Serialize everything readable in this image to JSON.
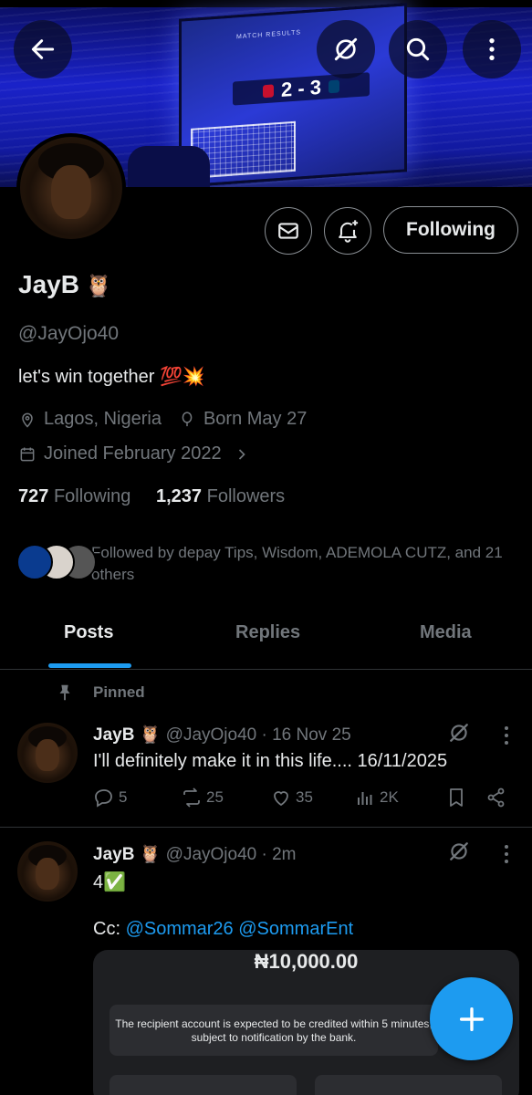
{
  "banner": {
    "tv_title": "MATCH RESULTS",
    "score": "2 - 3"
  },
  "header_buttons": [
    "back-icon",
    "grok-icon",
    "search-icon",
    "more-icon"
  ],
  "profile": {
    "name": "JayB",
    "name_emoji": "🦉",
    "handle": "@JayOjo40",
    "bio": "let's win together 💯💥",
    "location": "Lagos, Nigeria",
    "born": "Born May 27",
    "joined": "Joined February 2022",
    "following_count": "727",
    "following_label": "Following",
    "followers_count": "1,237",
    "followers_label": "Followers",
    "follow_button": "Following",
    "followed_by": "Followed by depay Tips, Wisdom, ADEMOLA CUTZ, and 21 others"
  },
  "tabs": [
    "Posts",
    "Replies",
    "Media"
  ],
  "posts": [
    {
      "pinned_label": "Pinned",
      "name": "JayB",
      "emoji": "🦉",
      "handle": "@JayOjo40",
      "time": "· 16 Nov 25",
      "text": "I'll definitely make it in this life.... 16/11/2025",
      "replies": "5",
      "reposts": "25",
      "likes": "35",
      "views": "2K"
    },
    {
      "name": "JayB",
      "emoji": "🦉",
      "handle": "@JayOjo40",
      "time": "· 2m",
      "text": "4✅",
      "cc_label": "Cc:",
      "mention1": "@Sommar26",
      "mention2": "@SommarEnt",
      "receipt_amount": "₦10,000.00",
      "receipt_notice": "The recipient account is expected to be credited within 5 minutes, subject to notification by the bank."
    }
  ],
  "colors": {
    "accent": "#1d9bf0",
    "background": "#000000",
    "muted": "#71767b",
    "text": "#e7e9ea"
  }
}
